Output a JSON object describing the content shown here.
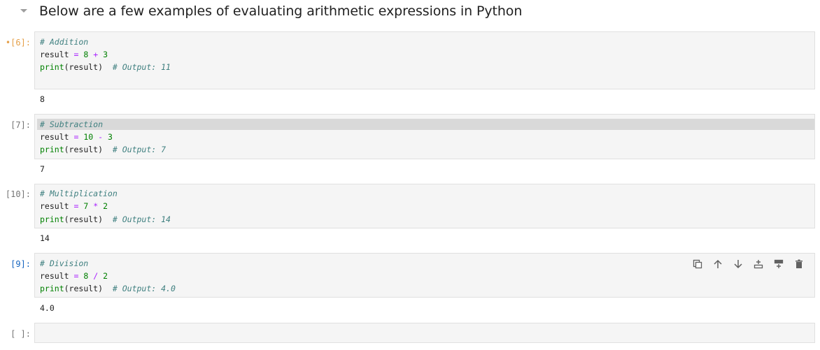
{
  "heading": {
    "text": "Below are a few examples of evaluating arithmetic expressions in Python"
  },
  "cells": [
    {
      "prompt": "•[6]:",
      "state": "running",
      "lines": [
        [
          {
            "t": "# Addition",
            "c": "cm"
          }
        ],
        [
          {
            "t": "result ",
            "c": ""
          },
          {
            "t": "=",
            "c": "op"
          },
          {
            "t": " ",
            "c": ""
          },
          {
            "t": "8",
            "c": "num"
          },
          {
            "t": " ",
            "c": ""
          },
          {
            "t": "+",
            "c": "op"
          },
          {
            "t": " ",
            "c": ""
          },
          {
            "t": "3",
            "c": "num"
          }
        ],
        [
          {
            "t": "print",
            "c": "fn"
          },
          {
            "t": "(result)  ",
            "c": ""
          },
          {
            "t": "# Output: 11",
            "c": "cm"
          }
        ]
      ],
      "output": "8"
    },
    {
      "prompt": "[7]:",
      "state": "done",
      "lines": [
        [
          {
            "t": "# Subtraction",
            "c": "cm"
          }
        ],
        [
          {
            "t": "result ",
            "c": ""
          },
          {
            "t": "=",
            "c": "op"
          },
          {
            "t": " ",
            "c": ""
          },
          {
            "t": "10",
            "c": "num"
          },
          {
            "t": " ",
            "c": ""
          },
          {
            "t": "-",
            "c": "op"
          },
          {
            "t": " ",
            "c": ""
          },
          {
            "t": "3",
            "c": "num"
          }
        ],
        [
          {
            "t": "print",
            "c": "fn"
          },
          {
            "t": "(result)  ",
            "c": ""
          },
          {
            "t": "# Output: 7",
            "c": "cm"
          }
        ]
      ],
      "output": "7"
    },
    {
      "prompt": "[10]:",
      "state": "done",
      "lines": [
        [
          {
            "t": "# Multiplication",
            "c": "cm"
          }
        ],
        [
          {
            "t": "result ",
            "c": ""
          },
          {
            "t": "=",
            "c": "op"
          },
          {
            "t": " ",
            "c": ""
          },
          {
            "t": "7",
            "c": "num"
          },
          {
            "t": " ",
            "c": ""
          },
          {
            "t": "*",
            "c": "op"
          },
          {
            "t": " ",
            "c": ""
          },
          {
            "t": "2",
            "c": "num"
          }
        ],
        [
          {
            "t": "print",
            "c": "fn"
          },
          {
            "t": "(result)  ",
            "c": ""
          },
          {
            "t": "# Output: 14",
            "c": "cm"
          }
        ]
      ],
      "output": "14"
    },
    {
      "prompt": "[9]:",
      "state": "active",
      "lines": [
        [
          {
            "t": "# Division",
            "c": "cm"
          }
        ],
        [
          {
            "t": "result ",
            "c": ""
          },
          {
            "t": "=",
            "c": "op"
          },
          {
            "t": " ",
            "c": ""
          },
          {
            "t": "8",
            "c": "num"
          },
          {
            "t": " ",
            "c": ""
          },
          {
            "t": "/",
            "c": "op"
          },
          {
            "t": " ",
            "c": ""
          },
          {
            "t": "2",
            "c": "num"
          }
        ],
        [
          {
            "t": "print",
            "c": "fn"
          },
          {
            "t": "(result)  ",
            "c": ""
          },
          {
            "t": "# Output: 4.0",
            "c": "cm"
          }
        ]
      ],
      "output": "4.0"
    },
    {
      "prompt": "[ ]:",
      "state": "empty",
      "lines": [],
      "output": ""
    }
  ],
  "cell_toolbar": {
    "icons": [
      "duplicate-icon",
      "move-up-icon",
      "move-down-icon",
      "insert-above-icon",
      "insert-below-icon",
      "delete-icon"
    ]
  },
  "colors": {
    "comment": "#408080",
    "operator": "#aa22ff",
    "number": "#008000",
    "builtin": "#008000",
    "active_prompt": "#1565c0",
    "running_prompt": "#e5a04a",
    "editor_bg": "#f5f5f5"
  }
}
